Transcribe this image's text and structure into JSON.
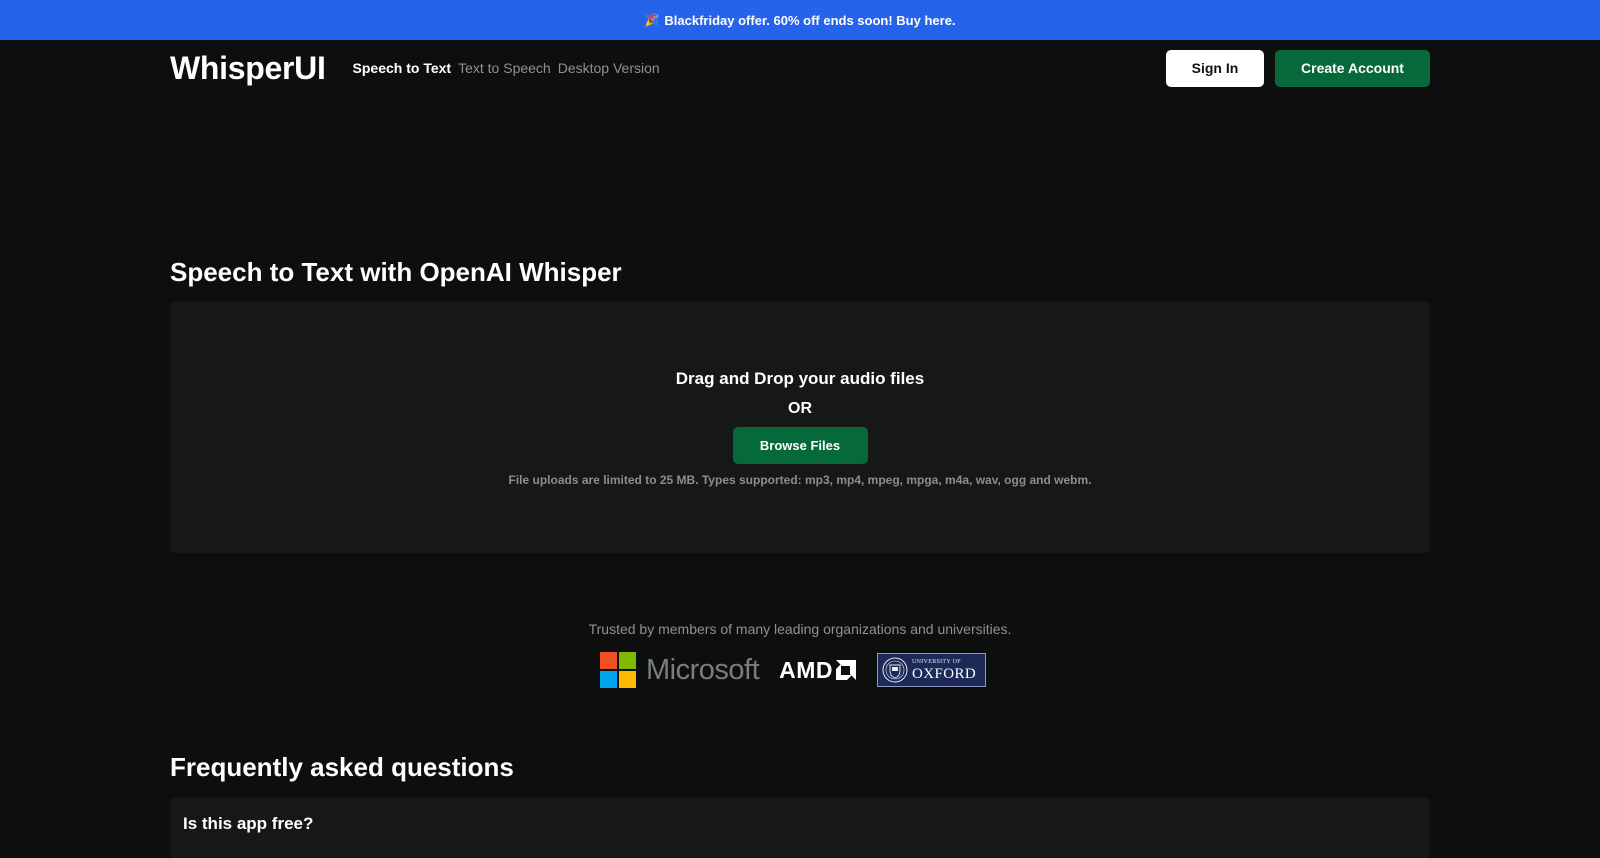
{
  "promo": {
    "icon": "party-popper-icon",
    "icon_glyph": "🎉",
    "text": "Blackfriday offer. 60% off ends soon! Buy here.",
    "color": "#2563eb"
  },
  "header": {
    "logo": "WhisperUI",
    "nav": [
      {
        "label": "Speech to Text",
        "active": true
      },
      {
        "label": "Text to Speech",
        "active": false
      },
      {
        "label": "Desktop Version",
        "active": false
      }
    ],
    "sign_in": "Sign In",
    "create_account": "Create Account",
    "accent_color": "#05693a"
  },
  "main": {
    "title": "Speech to Text with OpenAI Whisper",
    "dropzone": {
      "title": "Drag and Drop your audio files",
      "or": "OR",
      "browse": "Browse Files",
      "note": "File uploads are limited to 25 MB. Types supported: mp3, mp4, mpeg, mpga, m4a, wav, ogg and webm."
    }
  },
  "trusted": {
    "text": "Trusted by members of many leading organizations and universities.",
    "logos": {
      "microsoft": "Microsoft",
      "amd": "AMD",
      "oxford_top": "UNIVERSITY OF",
      "oxford_name": "OXFORD"
    }
  },
  "faq": {
    "title": "Frequently asked questions",
    "items": [
      {
        "question": "Is this app free?"
      }
    ]
  }
}
